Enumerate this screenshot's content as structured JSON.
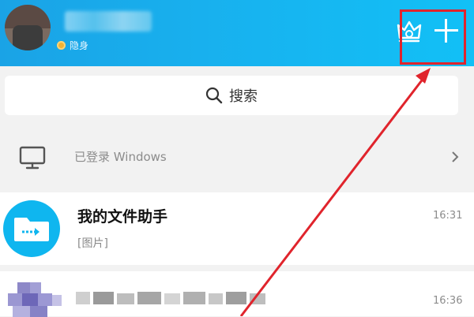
{
  "header": {
    "status_text": "隐身",
    "plus_label": "+"
  },
  "search": {
    "label": "搜索"
  },
  "device_bar": {
    "text": "已登录 Windows"
  },
  "chats": [
    {
      "name": "我的文件助手",
      "preview": "[图片]",
      "time": "16:31"
    },
    {
      "name": "",
      "preview": "",
      "time": "16:36"
    }
  ],
  "colors": {
    "header_gradient_start": "#1aa3e6",
    "header_gradient_end": "#12c0f6",
    "highlight_red": "#e0242c",
    "file_assistant_blue": "#0fb6ef"
  }
}
